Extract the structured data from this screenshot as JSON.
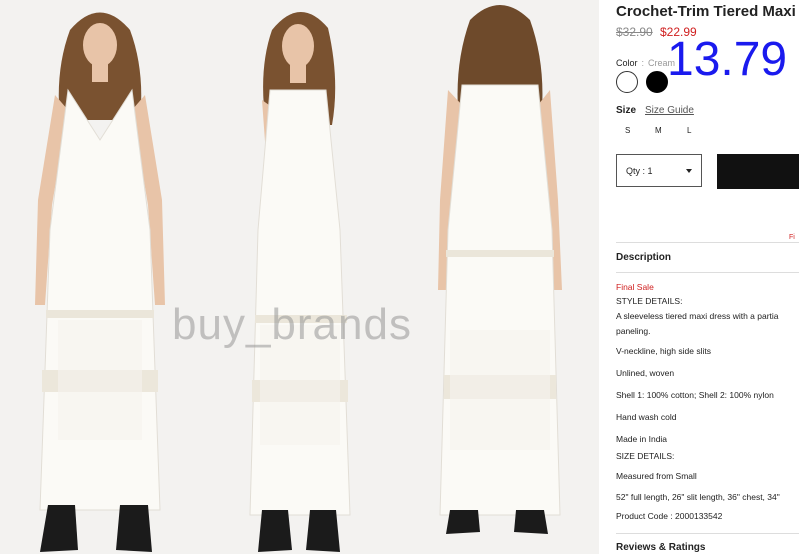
{
  "watermark": "buy_brands",
  "product": {
    "title": "Crochet-Trim Tiered Maxi",
    "old_price": "$32.90",
    "new_price": "$22.99",
    "overlay_price": "13.79"
  },
  "color": {
    "label": "Color",
    "separator": ":",
    "selected": "Cream",
    "swatches": [
      {
        "name": "Cream",
        "hex": "#ffffff"
      },
      {
        "name": "Black",
        "hex": "#000000"
      }
    ]
  },
  "size": {
    "label": "Size",
    "guide_label": "Size Guide",
    "options": [
      "S",
      "M",
      "L"
    ]
  },
  "quantity": {
    "label": "Qty : 1"
  },
  "side_note": "Fi",
  "description": {
    "heading": "Description",
    "final_sale": "Final Sale",
    "lines": [
      "STYLE DETAILS:",
      "A sleeveless tiered maxi dress with a partia",
      "paneling.",
      "V-neckline, high side slits",
      "Unlined, woven",
      "Shell 1: 100% cotton; Shell 2: 100% nylon",
      "Hand wash cold",
      "Made in India",
      "SIZE DETAILS:",
      "Measured from Small",
      "52\" full length, 26\" slit length, 36\" chest, 34\"",
      "Product Code : 2000133542"
    ]
  },
  "reviews": {
    "heading": "Reviews & Ratings"
  },
  "colors": {
    "accent_red": "#d02020",
    "overlay_blue": "#1a1aee",
    "button_black": "#111111"
  }
}
